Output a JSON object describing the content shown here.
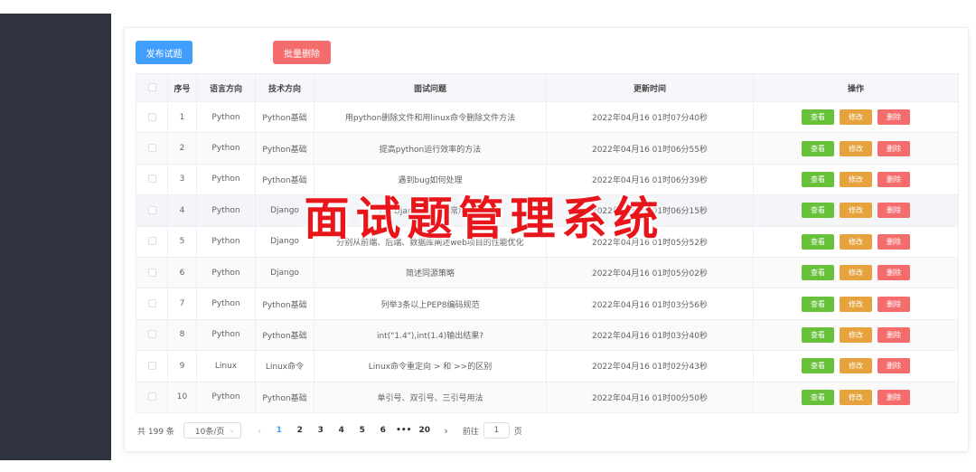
{
  "toolbar": {
    "publish_label": "发布试题",
    "bulk_delete_label": "批量删除"
  },
  "table": {
    "headers": {
      "index": "序号",
      "language": "语言方向",
      "tech": "技术方向",
      "question": "面试问题",
      "updated": "更新时间",
      "actions": "操作"
    },
    "rows": [
      {
        "index": "1",
        "language": "Python",
        "tech": "Python基础",
        "question": "用python删除文件和用linux命令删除文件方法",
        "updated": "2022年04月16 01时07分40秒"
      },
      {
        "index": "2",
        "language": "Python",
        "tech": "Python基础",
        "question": "提高python运行效率的方法",
        "updated": "2022年04月16 01时06分55秒"
      },
      {
        "index": "3",
        "language": "Python",
        "tech": "Python基础",
        "question": "遇到bug如何处理",
        "updated": "2022年04月16 01时06分39秒"
      },
      {
        "index": "4",
        "language": "Python",
        "tech": "Django",
        "question": "列举Django的ORM常用方法",
        "updated": "2022年04月16 01时06分15秒"
      },
      {
        "index": "5",
        "language": "Python",
        "tech": "Django",
        "question": "分别从前端、后端、数据库阐述web项目的性能优化",
        "updated": "2022年04月16 01时05分52秒"
      },
      {
        "index": "6",
        "language": "Python",
        "tech": "Django",
        "question": "简述同源策略",
        "updated": "2022年04月16 01时05分02秒"
      },
      {
        "index": "7",
        "language": "Python",
        "tech": "Python基础",
        "question": "列举3条以上PEP8编码规范",
        "updated": "2022年04月16 01时03分56秒"
      },
      {
        "index": "8",
        "language": "Python",
        "tech": "Python基础",
        "question": "int(\"1.4\"),int(1.4)输出结果?",
        "updated": "2022年04月16 01时03分40秒"
      },
      {
        "index": "9",
        "language": "Linux",
        "tech": "Linux命令",
        "question": "Linux命令重定向 > 和 >>的区别",
        "updated": "2022年04月16 01时02分43秒"
      },
      {
        "index": "10",
        "language": "Python",
        "tech": "Python基础",
        "question": "单引号、双引号、三引号用法",
        "updated": "2022年04月16 01时00分50秒"
      }
    ],
    "actions": {
      "view": "查看",
      "edit": "修改",
      "delete": "删除"
    }
  },
  "pagination": {
    "total": "共 199 条",
    "page_size": "10条/页",
    "pages": [
      "1",
      "2",
      "3",
      "4",
      "5",
      "6",
      "•••",
      "20"
    ],
    "current": "1",
    "goto_label": "前往",
    "goto_value": "1",
    "page_unit": "页"
  },
  "overlay_title": "面试题管理系统",
  "colors": {
    "primary": "#409eff",
    "success": "#67c23a",
    "warning": "#e6a23c",
    "danger": "#f56c6c",
    "sidebar": "#2f333e",
    "overlay": "#e8151b"
  }
}
